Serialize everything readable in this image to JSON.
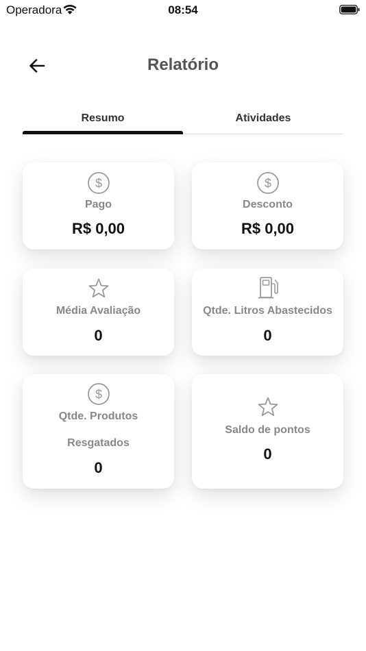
{
  "status_bar": {
    "carrier": "Operadora",
    "time": "08:54"
  },
  "header": {
    "title": "Relatório",
    "back_icon": "arrow-left-icon"
  },
  "tabs": [
    {
      "label": "Resumo",
      "active": true
    },
    {
      "label": "Atividades",
      "active": false
    }
  ],
  "cards": {
    "pago": {
      "icon": "dollar-circle-icon",
      "label": "Pago",
      "value": "R$ 0,00"
    },
    "desconto": {
      "icon": "dollar-circle-icon",
      "label": "Desconto",
      "value": "R$ 0,00"
    },
    "media_avaliacao": {
      "icon": "star-icon",
      "label": "Média Avaliação",
      "value": "0"
    },
    "litros": {
      "icon": "fuel-pump-icon",
      "label": "Qtde. Litros Abastecidos",
      "value": "0"
    },
    "produtos": {
      "icon": "dollar-circle-icon",
      "label_line1": "Qtde. Produtos",
      "label_line2": "Resgatados",
      "value": "0"
    },
    "saldo": {
      "icon": "star-icon",
      "label": "Saldo de pontos",
      "value": "0"
    }
  },
  "colors": {
    "icon_gray": "#9a9a9a",
    "label_gray": "#888888",
    "title_gray": "#555555",
    "active_tab": "#111111"
  }
}
